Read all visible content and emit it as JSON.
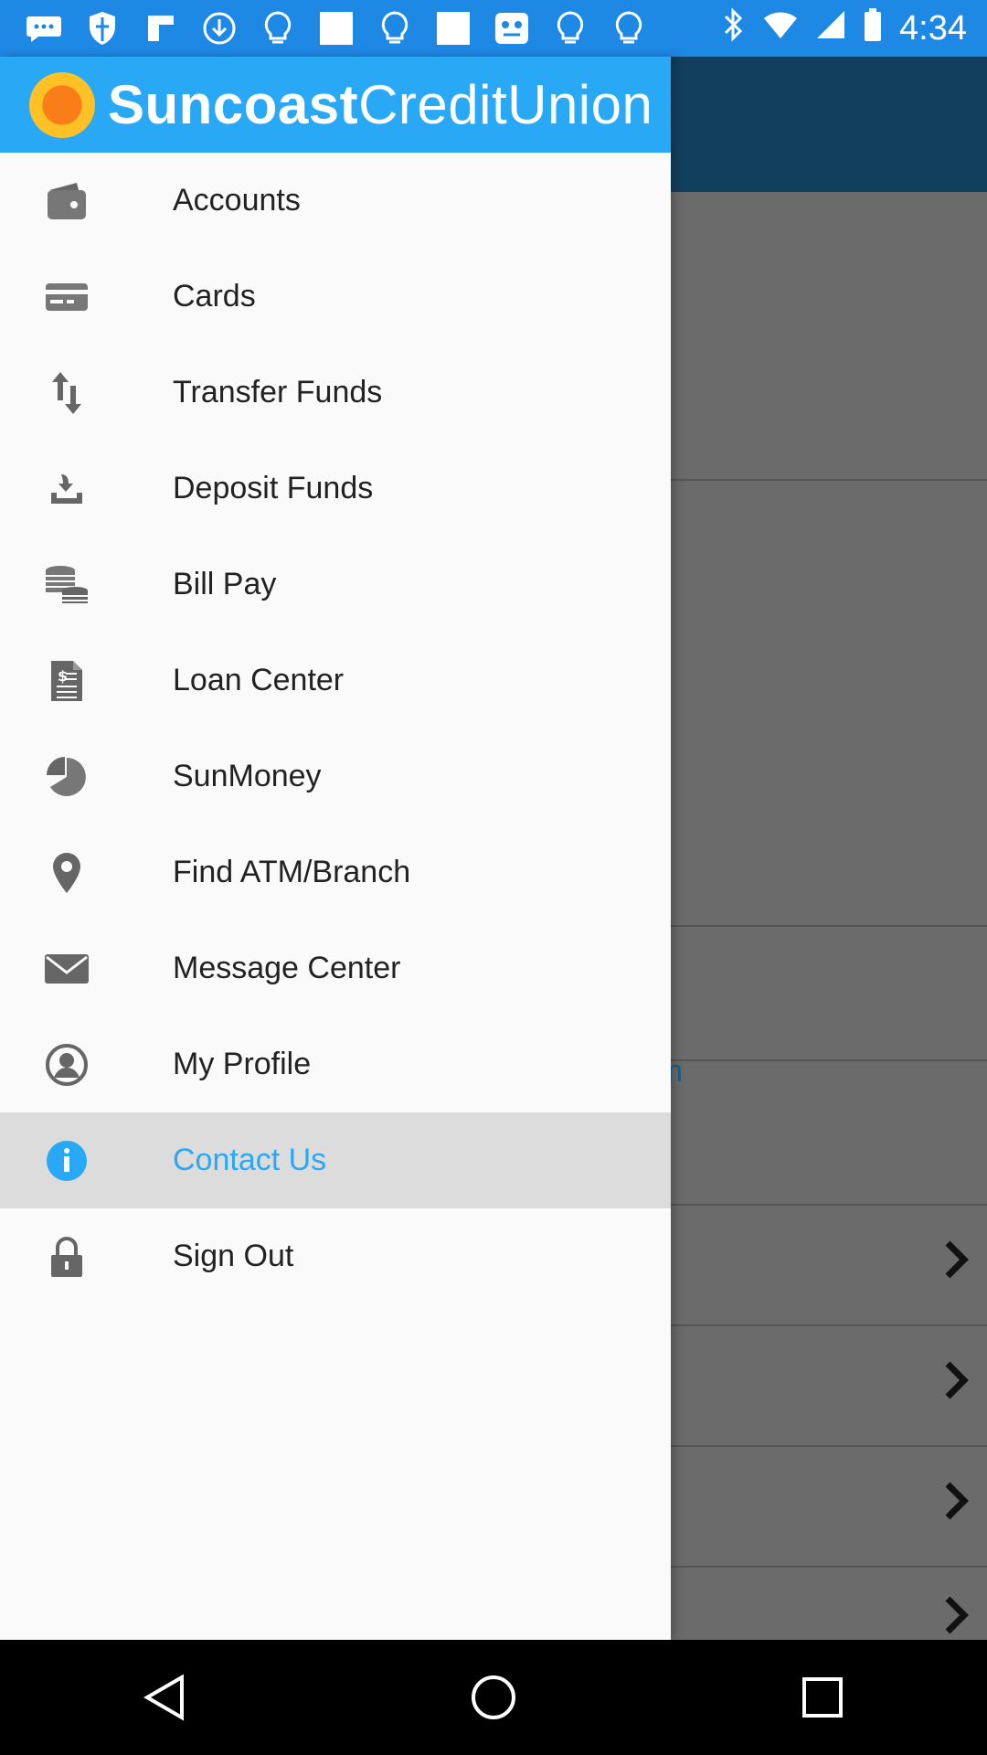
{
  "status_bar": {
    "time": "4:34",
    "notification_icons": [
      "chat-bubble-icon",
      "shield-icon",
      "flipboard-icon",
      "download-icon",
      "lightbulb-icon",
      "white-square-icon",
      "lightbulb-icon",
      "white-square-icon",
      "face-app-icon",
      "lightbulb-icon",
      "lightbulb-icon"
    ],
    "system_icons": [
      "bluetooth-icon",
      "wifi-icon",
      "signal-icon",
      "battery-icon"
    ]
  },
  "drawer": {
    "logo": {
      "bold": "Suncoast",
      "light": "CreditUnion"
    },
    "items": [
      {
        "label": "Accounts",
        "icon": "wallet-icon",
        "active": false
      },
      {
        "label": "Cards",
        "icon": "credit-card-icon",
        "active": false
      },
      {
        "label": "Transfer Funds",
        "icon": "transfer-arrows-icon",
        "active": false
      },
      {
        "label": "Deposit Funds",
        "icon": "deposit-tray-icon",
        "active": false
      },
      {
        "label": "Bill Pay",
        "icon": "coins-stack-icon",
        "active": false
      },
      {
        "label": "Loan Center",
        "icon": "document-dollar-icon",
        "active": false
      },
      {
        "label": "SunMoney",
        "icon": "pie-chart-icon",
        "active": false
      },
      {
        "label": "Find ATM/Branch",
        "icon": "location-pin-icon",
        "active": false
      },
      {
        "label": "Message Center",
        "icon": "envelope-icon",
        "active": false
      },
      {
        "label": "My Profile",
        "icon": "profile-circle-icon",
        "active": false
      },
      {
        "label": "Contact Us",
        "icon": "info-circle-icon",
        "active": true
      },
      {
        "label": "Sign Out",
        "icon": "padlock-icon",
        "active": false
      }
    ],
    "active_color": "#29a9f5"
  },
  "background": {
    "partial_link_text": "om"
  },
  "colors": {
    "status_bar": "#1e88e5",
    "drawer_header": "#29a9f5",
    "app_bar_dimmed": "#123f5e",
    "scrim": "#6b6b6b"
  }
}
